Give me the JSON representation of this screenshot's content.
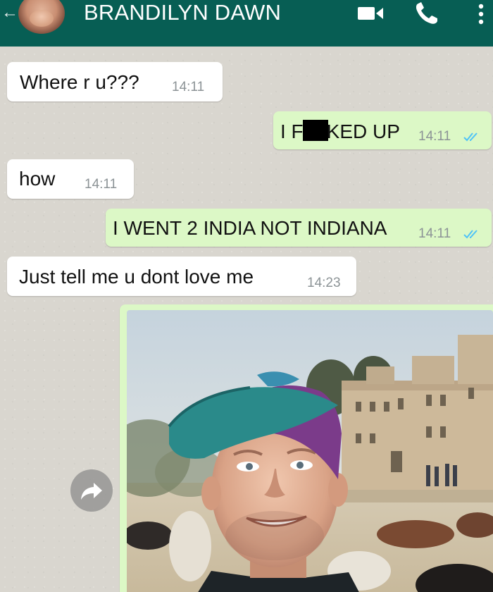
{
  "header": {
    "contact_name": "BRANDILYN DAWN",
    "background_color": "#075e54",
    "icons": {
      "back": "arrow-back-icon",
      "video": "video-call-icon",
      "phone": "voice-call-icon",
      "menu": "more-vert-icon"
    }
  },
  "messages": [
    {
      "direction": "incoming",
      "text": "Where r u???",
      "time": "14:11"
    },
    {
      "direction": "outgoing",
      "text_before": "I F",
      "text_after": "KED UP",
      "censored": true,
      "time": "14:11",
      "read": true
    },
    {
      "direction": "incoming",
      "text": "how",
      "time": "14:11"
    },
    {
      "direction": "outgoing",
      "text": "I WENT 2 INDIA NOT INDIANA",
      "time": "14:11",
      "read": true
    },
    {
      "direction": "incoming",
      "text": "Just tell me u dont love me",
      "time": "14:23"
    },
    {
      "direction": "outgoing",
      "type": "image",
      "image_description_icon": "selfie-photo"
    }
  ],
  "colors": {
    "incoming_bubble": "#ffffff",
    "outgoing_bubble": "#dcf8c6",
    "read_ticks": "#4fc3f7",
    "timestamp": "#8c9396"
  },
  "forward_icon": "forward-share-icon"
}
